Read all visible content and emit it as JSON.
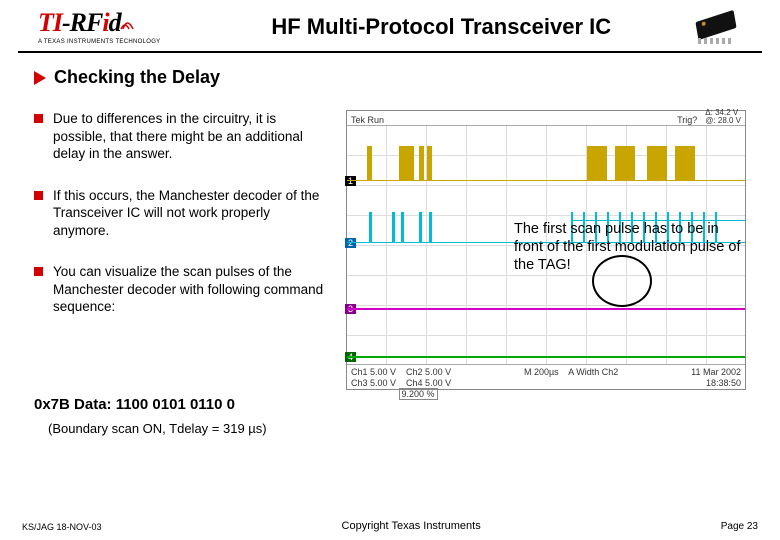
{
  "header": {
    "logo_ti": "TI",
    "logo_rfid": "-RFid",
    "logo_sub": "A TEXAS INSTRUMENTS TECHNOLOGY",
    "title": "HF Multi-Protocol Transceiver IC"
  },
  "section": {
    "title": "Checking the Delay"
  },
  "bullets": [
    "Due to differences in the circuitry, it is possible, that there might be an additional delay in the answer.",
    "If this occurs, the Manchester decoder of the Transceiver IC will not work properly anymore.",
    "You can visualize the scan pulses of the Manchester decoder with following command sequence:"
  ],
  "command_line": "0x7B Data: 1100 0101 0110 0",
  "command_sub": "(Boundary scan ON, Tdelay = 319 µs)",
  "scope": {
    "top_left": "Tek Run",
    "top_right": "Trig?",
    "cursor_a": "Δ: 34.2 V",
    "cursor_b": "@: 28.0 V",
    "ch1_label": "1",
    "ch2_label": "2",
    "ch3_label": "3",
    "ch4_label": "4",
    "bottom_ch1": "Ch1  5.00 V",
    "bottom_ch2": "Ch2  5.00 V",
    "bottom_ch3": "Ch3  5.00 V",
    "bottom_ch4": "Ch4  5.00 V",
    "bottom_time": "M 200µs",
    "bottom_a": "A  Width  Ch2",
    "bottom_pos": "9.200 %",
    "bottom_date": "11 Mar 2002",
    "bottom_clock": "18:38:50"
  },
  "annotation": "The first scan pulse has to be in front of the first modulation pulse of the TAG!",
  "footer": {
    "left": "KS/JAG 18-NOV-03",
    "center": "Copyright Texas Instruments",
    "right": "Page 23"
  }
}
